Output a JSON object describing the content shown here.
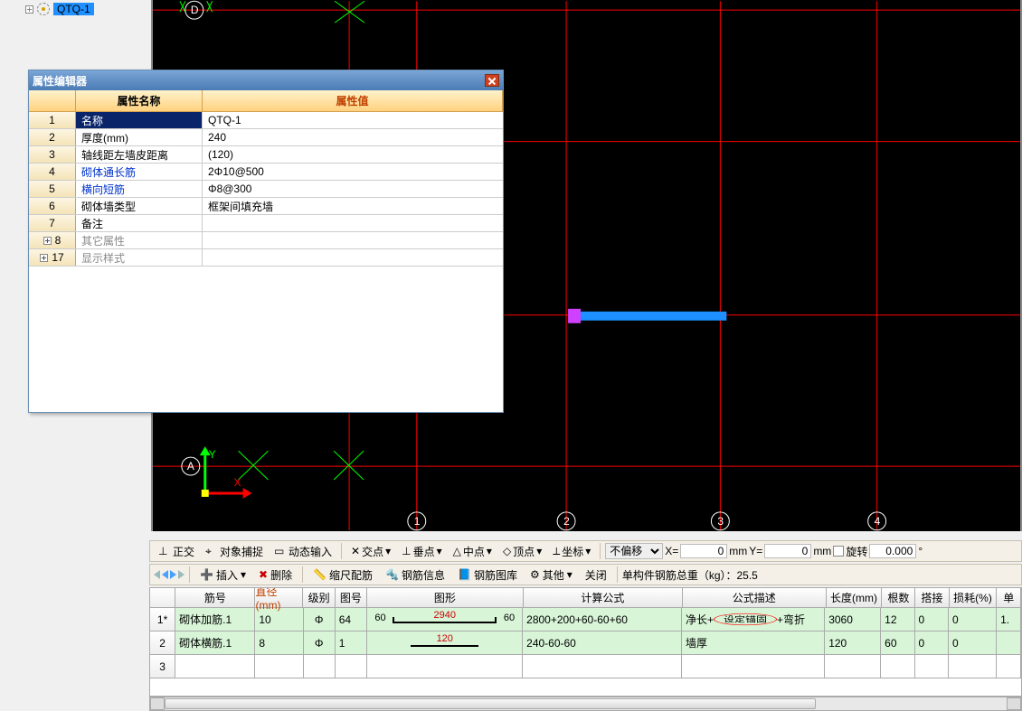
{
  "tree_item": {
    "label": "QTQ-1"
  },
  "cad": {
    "top_marker": "D",
    "left_marker": "A",
    "bottom_markers": [
      "1",
      "2",
      "3",
      "4"
    ],
    "axis_x_label": "X",
    "axis_y_label": "Y"
  },
  "prop_editor": {
    "title": "属性编辑器",
    "header_name": "属性名称",
    "header_value": "属性值",
    "rows": [
      {
        "num": "1",
        "name": "名称",
        "value": "QTQ-1",
        "selected": true
      },
      {
        "num": "2",
        "name": "厚度(mm)",
        "value": "240"
      },
      {
        "num": "3",
        "name": "轴线距左墙皮距离",
        "value": "(120)"
      },
      {
        "num": "4",
        "name": "砌体通长筋",
        "value": "2Φ10@500",
        "link": true
      },
      {
        "num": "5",
        "name": "横向短筋",
        "value": "Φ8@300",
        "link": true
      },
      {
        "num": "6",
        "name": "砌体墙类型",
        "value": "框架间填充墙"
      },
      {
        "num": "7",
        "name": "备注",
        "value": ""
      },
      {
        "num": "8",
        "name": "其它属性",
        "value": "",
        "expand": true,
        "grey": true
      },
      {
        "num": "17",
        "name": "显示样式",
        "value": "",
        "expand": true,
        "grey": true
      }
    ]
  },
  "toolbar1": {
    "ortho": "正交",
    "osnap": "对象捕捉",
    "dyninput": "动态输入",
    "cross": "交点",
    "perp": "垂点",
    "mid": "中点",
    "end": "顶点",
    "coord": "坐标",
    "offset_select": "不偏移",
    "x_label": "X=",
    "x_val": "0",
    "y_label": "Y=",
    "y_val": "0",
    "mm": "mm",
    "rotate": "旋转",
    "rotate_val": "0.000"
  },
  "toolbar2": {
    "insert": "插入",
    "delete": "删除",
    "scale": "缩尺配筋",
    "rebarinfo": "钢筋信息",
    "rebarlib": "钢筋图库",
    "other": "其他",
    "close": "关闭",
    "total_label": "单构件钢筋总重（kg）：25.5"
  },
  "table": {
    "headers": {
      "idx": "",
      "bar": "筋号",
      "dia": "直径(mm)",
      "lvl": "级别",
      "tno": "图号",
      "shape": "图形",
      "calc": "计算公式",
      "desc": "公式描述",
      "len": "长度(mm)",
      "cnt": "根数",
      "lap": "搭接",
      "loss": "损耗(%)",
      "extra": "单"
    },
    "rows": [
      {
        "idx": "1*",
        "bar": "砌体加筋.1",
        "dia": "10",
        "lvl": "Φ",
        "tno": "64",
        "shape_left": "60",
        "shape_mid": "2940",
        "shape_right": "60",
        "calc": "2800+200+60-60+60",
        "desc_pre": "净长+",
        "desc_circled": "设定锚固",
        "desc_post": "+弯折",
        "len": "3060",
        "cnt": "12",
        "lap": "0",
        "loss": "0",
        "extra": "1."
      },
      {
        "idx": "2",
        "bar": "砌体横筋.1",
        "dia": "8",
        "lvl": "Φ",
        "tno": "1",
        "shape_left": "",
        "shape_mid": "120",
        "shape_right": "",
        "calc": "240-60-60",
        "desc_pre": "墙厚",
        "desc_circled": "",
        "desc_post": "",
        "len": "120",
        "cnt": "60",
        "lap": "0",
        "loss": "0",
        "extra": ""
      },
      {
        "idx": "3",
        "bar": "",
        "dia": "",
        "lvl": "",
        "tno": "",
        "shape_left": "",
        "shape_mid": "",
        "shape_right": "",
        "calc": "",
        "desc_pre": "",
        "desc_circled": "",
        "desc_post": "",
        "len": "",
        "cnt": "",
        "lap": "",
        "loss": "",
        "extra": ""
      }
    ]
  }
}
